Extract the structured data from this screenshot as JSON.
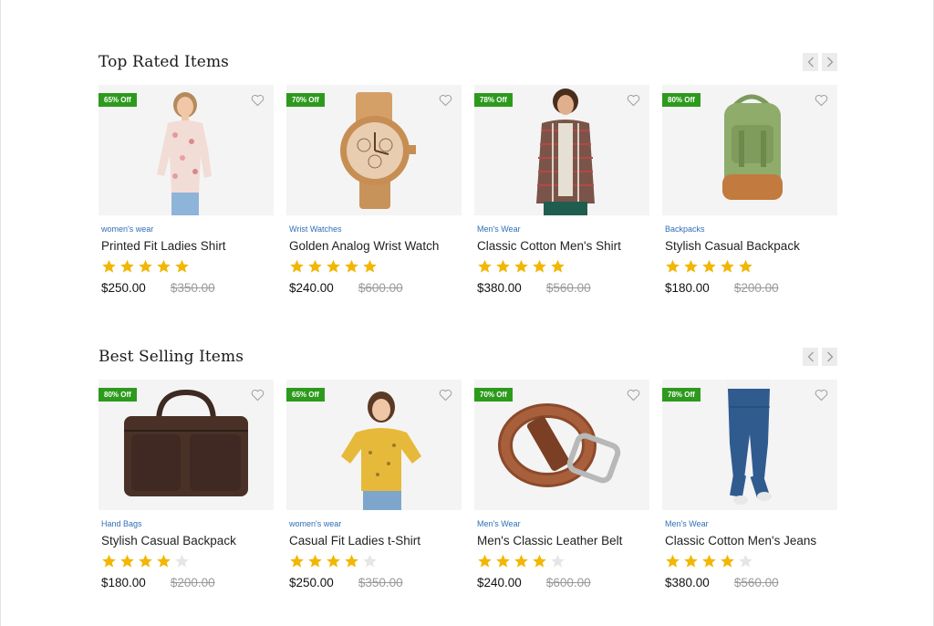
{
  "colors": {
    "badge": "#2d9a1d",
    "category": "#2f6fb7",
    "star_filled": "#f2b705",
    "star_empty": "#e6e6e6"
  },
  "sections": [
    {
      "title": "Top Rated Items",
      "products": [
        {
          "badge": "65% Off",
          "category": "women's wear",
          "name": "Printed Fit Ladies Shirt",
          "rating": 5,
          "price": "$250.00",
          "old_price": "$350.00",
          "image": "woman-floral-shirt"
        },
        {
          "badge": "70% Off",
          "category": "Wrist Watches",
          "name": "Golden Analog Wrist Watch",
          "rating": 5,
          "price": "$240.00",
          "old_price": "$600.00",
          "image": "gold-watch"
        },
        {
          "badge": "78% Off",
          "category": "Men's Wear",
          "name": "Classic Cotton Men's Shirt",
          "rating": 5,
          "price": "$380.00",
          "old_price": "$560.00",
          "image": "man-plaid-shirt"
        },
        {
          "badge": "80% Off",
          "category": "Backpacks",
          "name": "Stylish Casual Backpack",
          "rating": 5,
          "price": "$180.00",
          "old_price": "$200.00",
          "image": "green-backpack"
        }
      ]
    },
    {
      "title": "Best Selling Items",
      "products": [
        {
          "badge": "80% Off",
          "category": "Hand Bags",
          "name": "Stylish Casual Backpack",
          "rating": 4,
          "price": "$180.00",
          "old_price": "$200.00",
          "image": "leather-bag"
        },
        {
          "badge": "65% Off",
          "category": "women's wear",
          "name": "Casual Fit Ladies t-Shirt",
          "rating": 4,
          "price": "$250.00",
          "old_price": "$350.00",
          "image": "woman-yellow-tshirt"
        },
        {
          "badge": "70% Off",
          "category": "Men's Wear",
          "name": "Men's Classic Leather Belt",
          "rating": 4,
          "price": "$240.00",
          "old_price": "$600.00",
          "image": "leather-belt"
        },
        {
          "badge": "78% Off",
          "category": "Men's Wear",
          "name": "Classic Cotton Men's Jeans",
          "rating": 4,
          "price": "$380.00",
          "old_price": "$560.00",
          "image": "blue-jeans"
        }
      ]
    }
  ]
}
